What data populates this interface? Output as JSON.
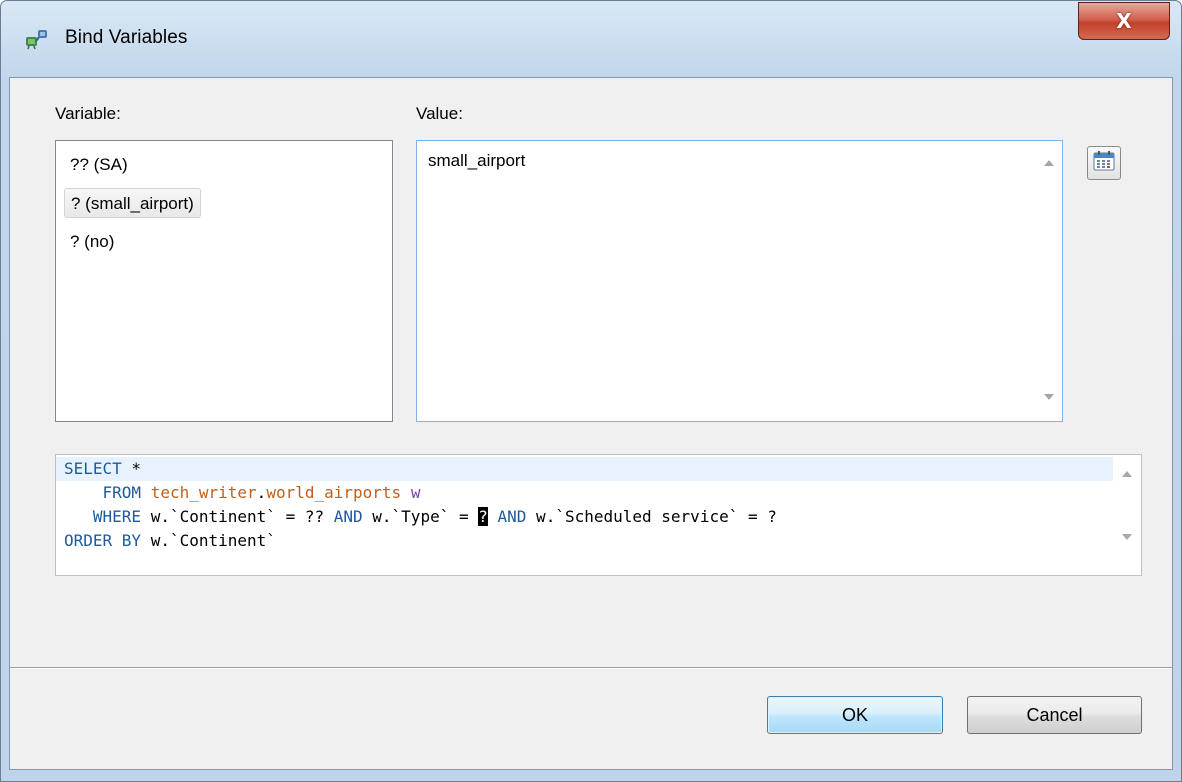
{
  "window": {
    "title": "Bind Variables",
    "close_glyph": "X"
  },
  "variables": {
    "label": "Variable:",
    "items": [
      {
        "label": "?? (SA)",
        "selected": false
      },
      {
        "label": "? (small_airport)",
        "selected": true
      },
      {
        "label": "? (no)",
        "selected": false
      }
    ]
  },
  "value": {
    "label": "Value:",
    "current": "small_airport"
  },
  "sql": {
    "lines": [
      [
        {
          "t": "SELECT",
          "c": "kw"
        },
        {
          "t": " *",
          "c": ""
        }
      ],
      [
        {
          "t": "    FROM ",
          "c": "kw"
        },
        {
          "t": "tech_writer",
          "c": "tbl"
        },
        {
          "t": ".",
          "c": ""
        },
        {
          "t": "world_airports",
          "c": "tbl"
        },
        {
          "t": " ",
          "c": ""
        },
        {
          "t": "w",
          "c": "alias"
        }
      ],
      [
        {
          "t": "   WHERE ",
          "c": "kw"
        },
        {
          "t": "w.`Continent` = ?? ",
          "c": ""
        },
        {
          "t": "AND",
          "c": "kw"
        },
        {
          "t": " w.`Type` = ",
          "c": ""
        },
        {
          "t": "?",
          "c": "cursor-q"
        },
        {
          "t": " ",
          "c": ""
        },
        {
          "t": "AND",
          "c": "kw"
        },
        {
          "t": " w.`Scheduled service` = ?",
          "c": ""
        }
      ],
      [
        {
          "t": "ORDER BY",
          "c": "kw"
        },
        {
          "t": " w.`Continent`",
          "c": ""
        }
      ]
    ]
  },
  "buttons": {
    "ok": "OK",
    "cancel": "Cancel"
  },
  "icons": {
    "app": "database-connection-icon",
    "calendar": "calendar-icon"
  },
  "colors": {
    "keyword": "#1d5a9e",
    "table": "#c0601a",
    "alias": "#7f3fa0",
    "close_button": "#c1412b",
    "default_button_border": "#3c7fb1"
  }
}
